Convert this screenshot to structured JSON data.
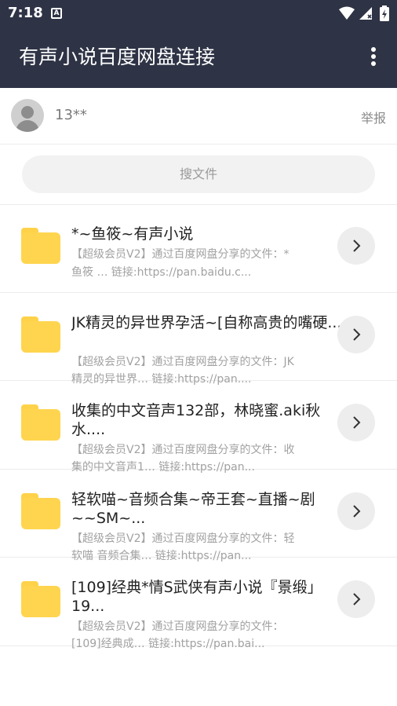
{
  "status": {
    "time": "7:18",
    "a_icon": "A"
  },
  "toolbar": {
    "title": "有声小说百度网盘连接",
    "menu_icon": "more-vert-icon"
  },
  "user": {
    "name": "13**",
    "report_label": "举报"
  },
  "search": {
    "placeholder": "搜文件"
  },
  "items": [
    {
      "title": "*~鱼筱~有声小说",
      "desc_line1": "【超级会员V2】通过百度网盘分享的文件：*",
      "desc_line2": "鱼筱 … 链接:https://pan.baidu.c..."
    },
    {
      "title": "JK精灵的异世界孕活~[自称高贵的嘴硬...",
      "desc_line1": "【超级会员V2】通过百度网盘分享的文件：JK",
      "desc_line2": "精灵的异世界… 链接:https://pan...."
    },
    {
      "title": "收集的中文音声132部，林晓蜜.aki秋水....",
      "desc_line1": "【超级会员V2】通过百度网盘分享的文件：收",
      "desc_line2": "集的中文音声1… 链接:https://pan..."
    },
    {
      "title": "轻软喵~音频合集~帝王套~直播~剧~~SM~...",
      "desc_line1": "【超级会员V2】通过百度网盘分享的文件：轻",
      "desc_line2": "软喵 音频合集… 链接:https://pan..."
    },
    {
      "title": "[109]经典*情S武侠有声小说『景缎」19...",
      "desc_line1": "【超级会员V2】通过百度网盘分享的文件：",
      "desc_line2": "[109]经典成… 链接:https://pan.bai..."
    }
  ],
  "colors": {
    "toolbar_bg": "#2e3345",
    "folder": "#ffd54f"
  }
}
